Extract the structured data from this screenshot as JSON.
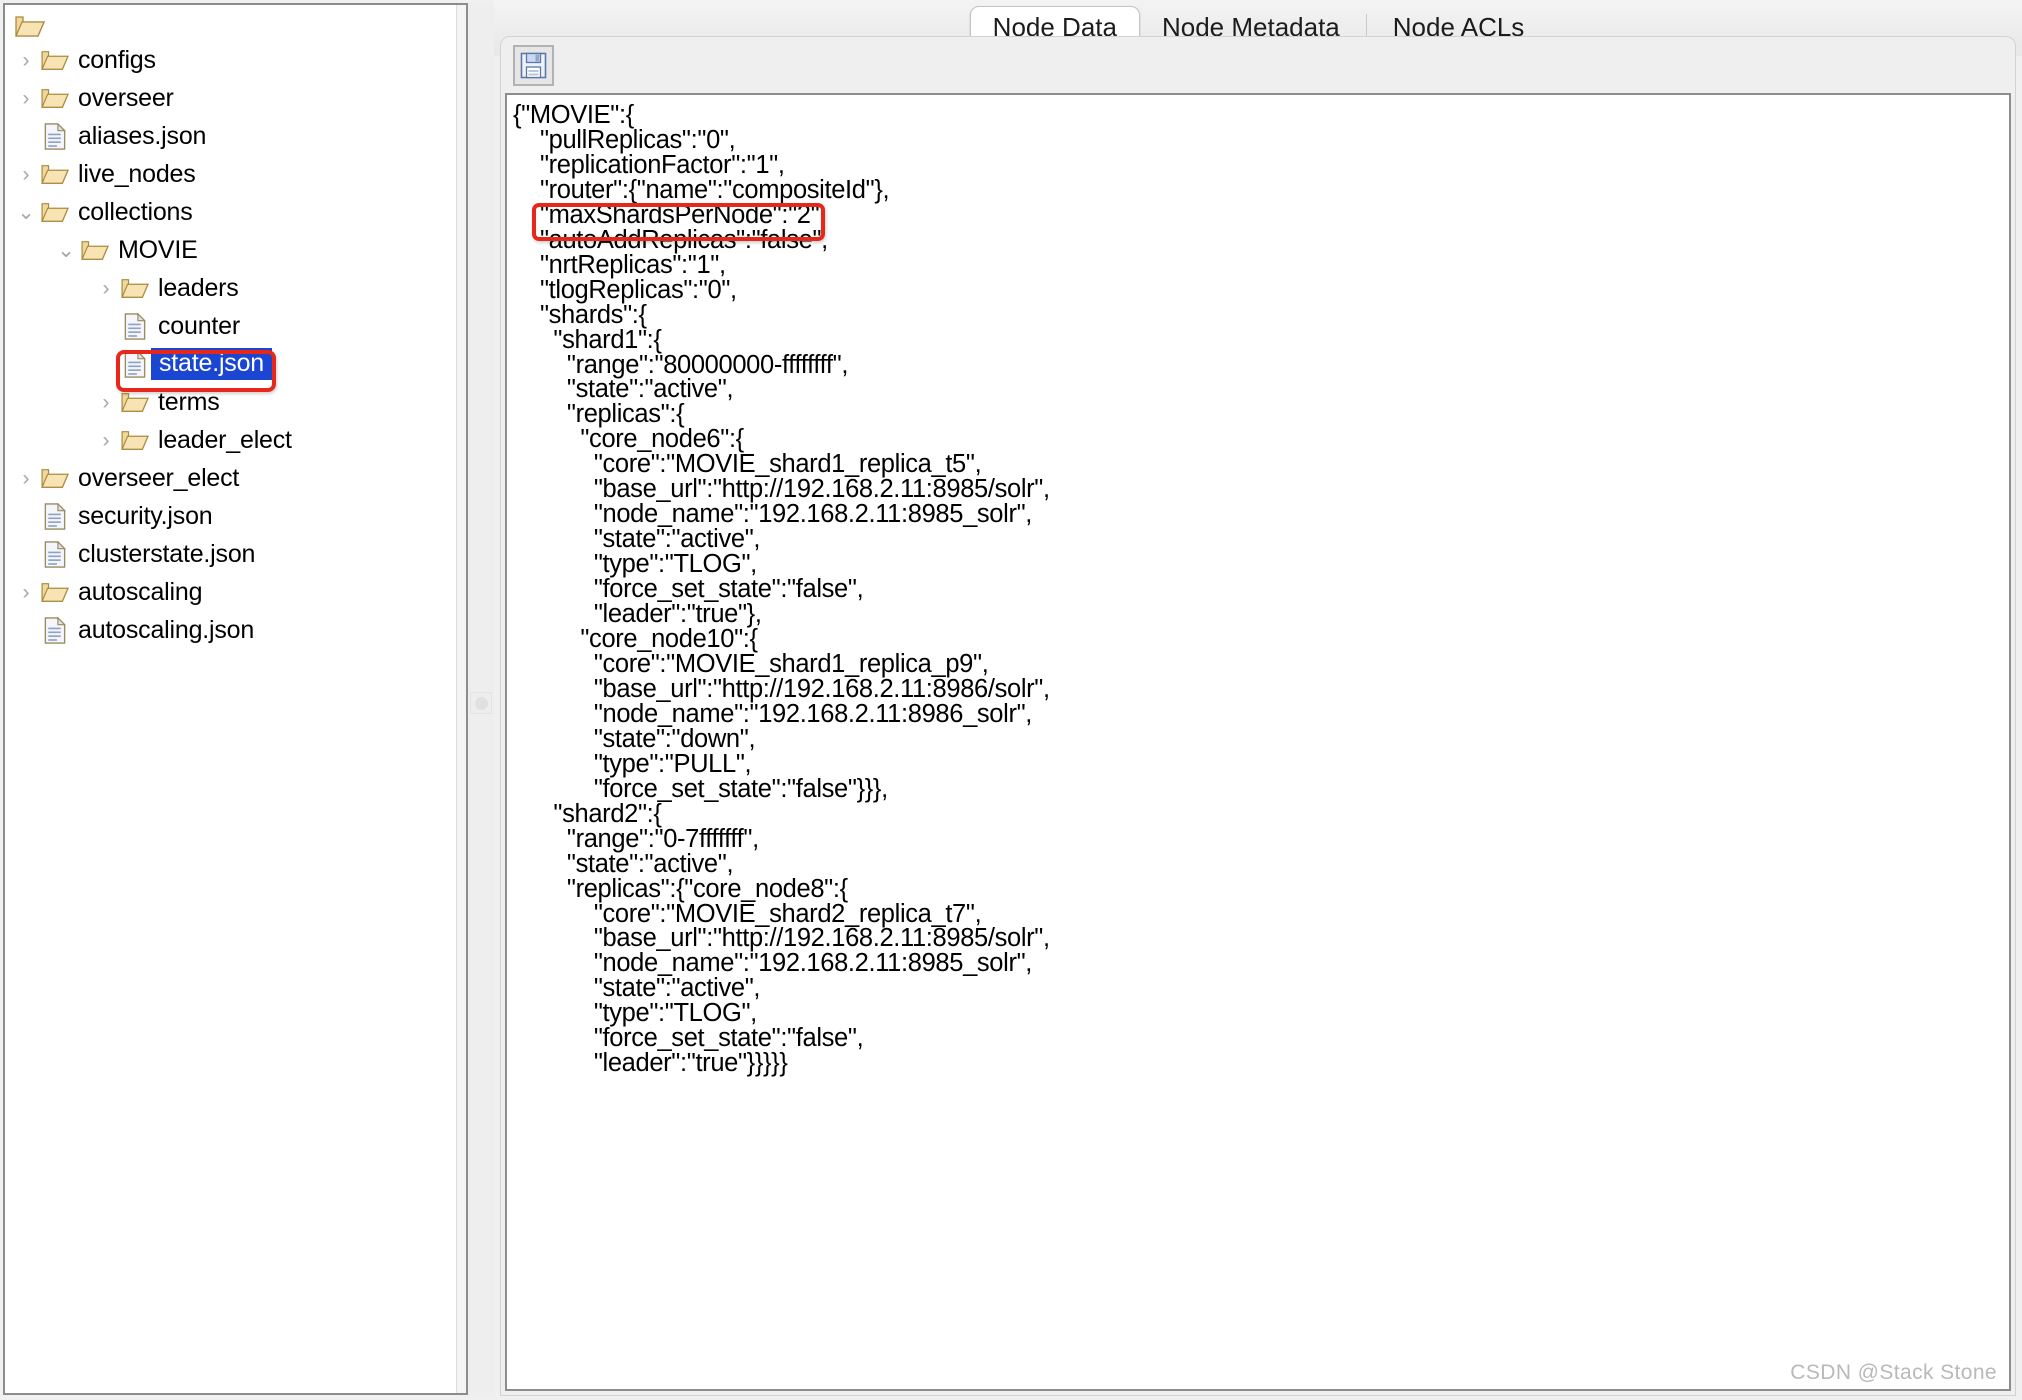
{
  "tree": {
    "root_icon": "folder-icon",
    "items": [
      {
        "label": "configs",
        "icon": "folder-icon",
        "level": 0,
        "twisty": "collapsed",
        "selected": false
      },
      {
        "label": "overseer",
        "icon": "folder-icon",
        "level": 0,
        "twisty": "collapsed",
        "selected": false
      },
      {
        "label": "aliases.json",
        "icon": "document-icon",
        "level": 0,
        "twisty": "none",
        "selected": false
      },
      {
        "label": "live_nodes",
        "icon": "folder-icon",
        "level": 0,
        "twisty": "collapsed",
        "selected": false
      },
      {
        "label": "collections",
        "icon": "folder-icon",
        "level": 0,
        "twisty": "expanded",
        "selected": false
      },
      {
        "label": "MOVIE",
        "icon": "folder-icon",
        "level": 1,
        "twisty": "expanded",
        "selected": false
      },
      {
        "label": "leaders",
        "icon": "folder-icon",
        "level": 2,
        "twisty": "collapsed",
        "selected": false
      },
      {
        "label": "counter",
        "icon": "document-icon",
        "level": 2,
        "twisty": "none",
        "selected": false
      },
      {
        "label": "state.json",
        "icon": "document-icon",
        "level": 2,
        "twisty": "none",
        "selected": true
      },
      {
        "label": "terms",
        "icon": "folder-icon",
        "level": 2,
        "twisty": "collapsed",
        "selected": false
      },
      {
        "label": "leader_elect",
        "icon": "folder-icon",
        "level": 2,
        "twisty": "collapsed",
        "selected": false
      },
      {
        "label": "overseer_elect",
        "icon": "folder-icon",
        "level": 0,
        "twisty": "collapsed",
        "selected": false
      },
      {
        "label": "security.json",
        "icon": "document-icon",
        "level": 0,
        "twisty": "none",
        "selected": false
      },
      {
        "label": "clusterstate.json",
        "icon": "document-icon",
        "level": 0,
        "twisty": "none",
        "selected": false
      },
      {
        "label": "autoscaling",
        "icon": "folder-icon",
        "level": 0,
        "twisty": "collapsed",
        "selected": false
      },
      {
        "label": "autoscaling.json",
        "icon": "document-icon",
        "level": 0,
        "twisty": "none",
        "selected": false
      }
    ],
    "annotation_color": "#e8271b",
    "selection_color": "#1b46d2"
  },
  "tabs": {
    "items": [
      {
        "label": "Node Data",
        "active": true
      },
      {
        "label": "Node Metadata",
        "active": false
      },
      {
        "label": "Node ACLs",
        "active": false
      }
    ]
  },
  "toolbar": {
    "save_icon": "save-floppy-icon",
    "save_title": "Save"
  },
  "editor": {
    "content": "{\"MOVIE\":{\n    \"pullReplicas\":\"0\",\n    \"replicationFactor\":\"1\",\n    \"router\":{\"name\":\"compositeId\"},\n    \"maxShardsPerNode\":\"2\",\n    \"autoAddReplicas\":\"false\",\n    \"nrtReplicas\":\"1\",\n    \"tlogReplicas\":\"0\",\n    \"shards\":{\n      \"shard1\":{\n        \"range\":\"80000000-ffffffff\",\n        \"state\":\"active\",\n        \"replicas\":{\n          \"core_node6\":{\n            \"core\":\"MOVIE_shard1_replica_t5\",\n            \"base_url\":\"http://192.168.2.11:8985/solr\",\n            \"node_name\":\"192.168.2.11:8985_solr\",\n            \"state\":\"active\",\n            \"type\":\"TLOG\",\n            \"force_set_state\":\"false\",\n            \"leader\":\"true\"},\n          \"core_node10\":{\n            \"core\":\"MOVIE_shard1_replica_p9\",\n            \"base_url\":\"http://192.168.2.11:8986/solr\",\n            \"node_name\":\"192.168.2.11:8986_solr\",\n            \"state\":\"down\",\n            \"type\":\"PULL\",\n            \"force_set_state\":\"false\"}}},\n      \"shard2\":{\n        \"range\":\"0-7fffffff\",\n        \"state\":\"active\",\n        \"replicas\":{\"core_node8\":{\n            \"core\":\"MOVIE_shard2_replica_t7\",\n            \"base_url\":\"http://192.168.2.11:8985/solr\",\n            \"node_name\":\"192.168.2.11:8985_solr\",\n            \"state\":\"active\",\n            \"type\":\"TLOG\",\n            \"force_set_state\":\"false\",\n            \"leader\":\"true\"}}}}}",
    "highlighted_line": "\"autoAddReplicas\":\"false\","
  },
  "watermark": {
    "text": "CSDN @Stack Stone"
  }
}
